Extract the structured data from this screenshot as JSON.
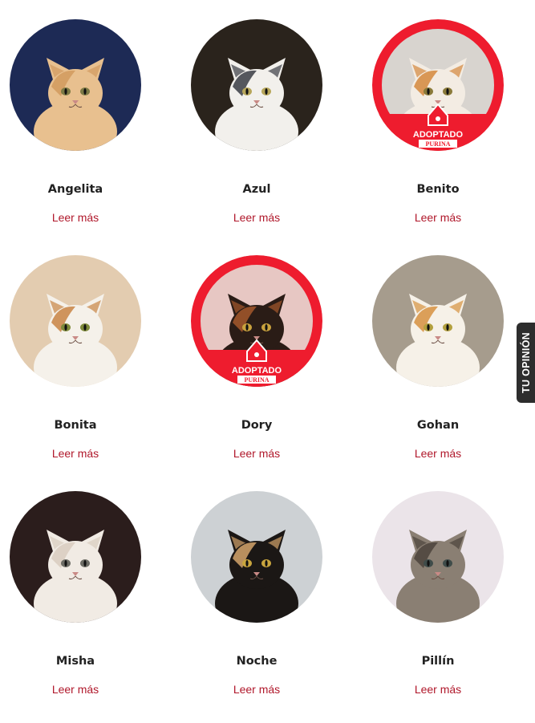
{
  "cats": [
    {
      "name": "Angelita",
      "link": "Leer más",
      "adopted": false,
      "bg": "#1d2a55",
      "fur": "#e8c08f",
      "mark": "#d19a5e",
      "eye": "#7d7a45"
    },
    {
      "name": "Azul",
      "link": "Leer más",
      "adopted": false,
      "bg": "#2a231c",
      "fur": "#f2f0ec",
      "mark": "#3a3c44",
      "eye": "#b7a65a"
    },
    {
      "name": "Benito",
      "link": "Leer más",
      "adopted": true,
      "badge": "ADOPTADO",
      "brand": "PURINA",
      "bg": "#d8d4cf",
      "fur": "#f3ece3",
      "mark": "#d3883c",
      "eye": "#8a7a3a"
    },
    {
      "name": "Bonita",
      "link": "Leer más",
      "adopted": false,
      "bg": "#e3ccb0",
      "fur": "#f5f1ea",
      "mark": "#c88444",
      "eye": "#7e8a3a"
    },
    {
      "name": "Dory",
      "link": "Leer más",
      "adopted": true,
      "badge": "ADOPTADO",
      "brand": "PURINA",
      "bg": "#e7c7c3",
      "fur": "#2a1c16",
      "mark": "#a5582c",
      "eye": "#c9a23e"
    },
    {
      "name": "Gohan",
      "link": "Leer más",
      "adopted": false,
      "bg": "#a69c8d",
      "fur": "#f6f1e8",
      "mark": "#d6913f",
      "eye": "#b3a03e"
    },
    {
      "name": "Misha",
      "link": "Leer más",
      "adopted": false,
      "bg": "#2b1d1c",
      "fur": "#f1ebe4",
      "mark": "#d9cdbf",
      "eye": "#6d6c65"
    },
    {
      "name": "Noche",
      "link": "Leer más",
      "adopted": false,
      "bg": "#cdd1d4",
      "fur": "#1b1715",
      "mark": "#d3a46b",
      "eye": "#c9a53e"
    },
    {
      "name": "Pillín",
      "link": "Leer más",
      "adopted": false,
      "bg": "#ebe4e9",
      "fur": "#8a7f73",
      "mark": "#4b433c",
      "eye": "#3f4c4a"
    }
  ],
  "feedback": {
    "label": "TU OPINIÓN"
  },
  "colors": {
    "accent": "#b0182b",
    "adopted_ring": "#ee1c2e",
    "tab_bg": "#2d2d2d"
  }
}
